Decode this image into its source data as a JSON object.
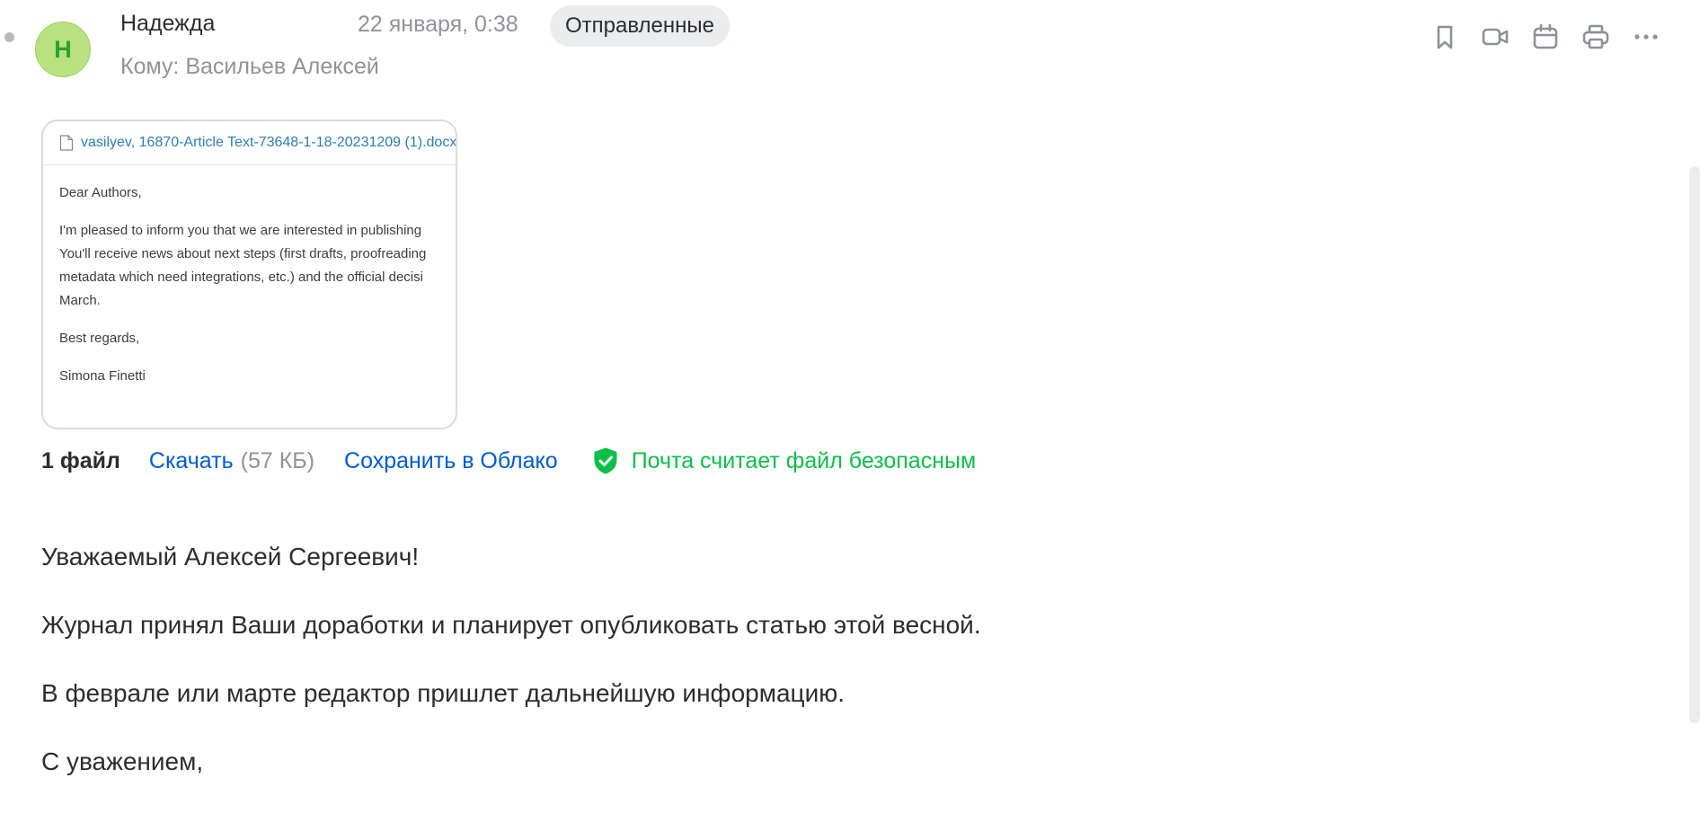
{
  "header": {
    "sender_initial": "Н",
    "sender_name": "Надежда",
    "date": "22 января, 0:38",
    "folder_badge": "Отправленные",
    "recipient_line": "Кому: Васильев Алексей"
  },
  "toolbar": {
    "items": [
      {
        "icon": "bookmark-icon"
      },
      {
        "icon": "video-call-icon"
      },
      {
        "icon": "calendar-icon"
      },
      {
        "icon": "print-icon"
      },
      {
        "icon": "more-icon"
      }
    ]
  },
  "attachment": {
    "file_name": "vasilyev, 16870-Article Text-73648-1-18-20231209 (1).docx",
    "preview_lines": [
      "Dear Authors,",
      "I'm pleased to inform you that we are interested in publishing",
      "You'll receive news about next steps (first drafts, proofreading",
      "metadata which need integrations, etc.) and the official decisi",
      "March.",
      "Best regards,",
      "Simona Finetti"
    ]
  },
  "file_bar": {
    "count": "1 файл",
    "download_label": "Скачать",
    "size": "(57 КБ)",
    "save_cloud_label": "Сохранить в Облако",
    "safe_text": "Почта считает файл безопасным",
    "safe_color": "#0cbf49"
  },
  "body": {
    "paragraphs": [
      "Уважаемый Алексей Сергеевич!",
      "Журнал принял Ваши доработки и планирует опубликовать статью этой весной.",
      "В феврале или марте редактор пришлет дальнейшую информацию.",
      "С уважением,"
    ]
  },
  "colors": {
    "link": "#005bd1",
    "avatar_bg": "#b7e27f",
    "avatar_text": "#2f9e35",
    "muted": "#919399"
  }
}
